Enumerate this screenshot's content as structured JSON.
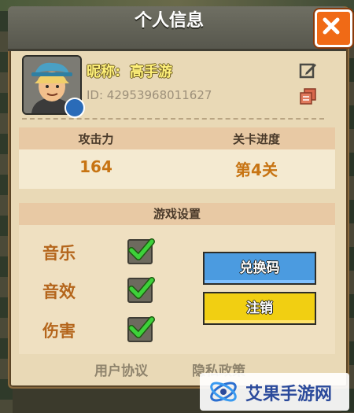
{
  "header": {
    "title": "个人信息"
  },
  "profile": {
    "nickname_label": "昵称:",
    "nickname": "高手游",
    "id_text": "ID: 42953968011627"
  },
  "stats": {
    "attack_label": "攻击力",
    "attack_value": "164",
    "progress_label": "关卡进度",
    "progress_value": "第4关"
  },
  "settings": {
    "title": "游戏设置",
    "options": [
      {
        "label": "音乐",
        "checked": true
      },
      {
        "label": "音效",
        "checked": true
      },
      {
        "label": "伤害",
        "checked": true
      }
    ],
    "redeem_label": "兑换码",
    "logout_label": "注销"
  },
  "footer": {
    "user_agreement": "用户协议",
    "privacy_policy": "隐私政策"
  },
  "watermark": {
    "text": "艾果手游网"
  },
  "colors": {
    "accent_orange": "#f06a16",
    "button_blue": "#4b9be0",
    "button_yellow": "#f1cf12",
    "check_green": "#3dd13a",
    "value_orange": "#c77413"
  },
  "icons": [
    "close-icon",
    "edit-icon",
    "copy-icon",
    "check-icon",
    "avatar-badge-icon"
  ]
}
